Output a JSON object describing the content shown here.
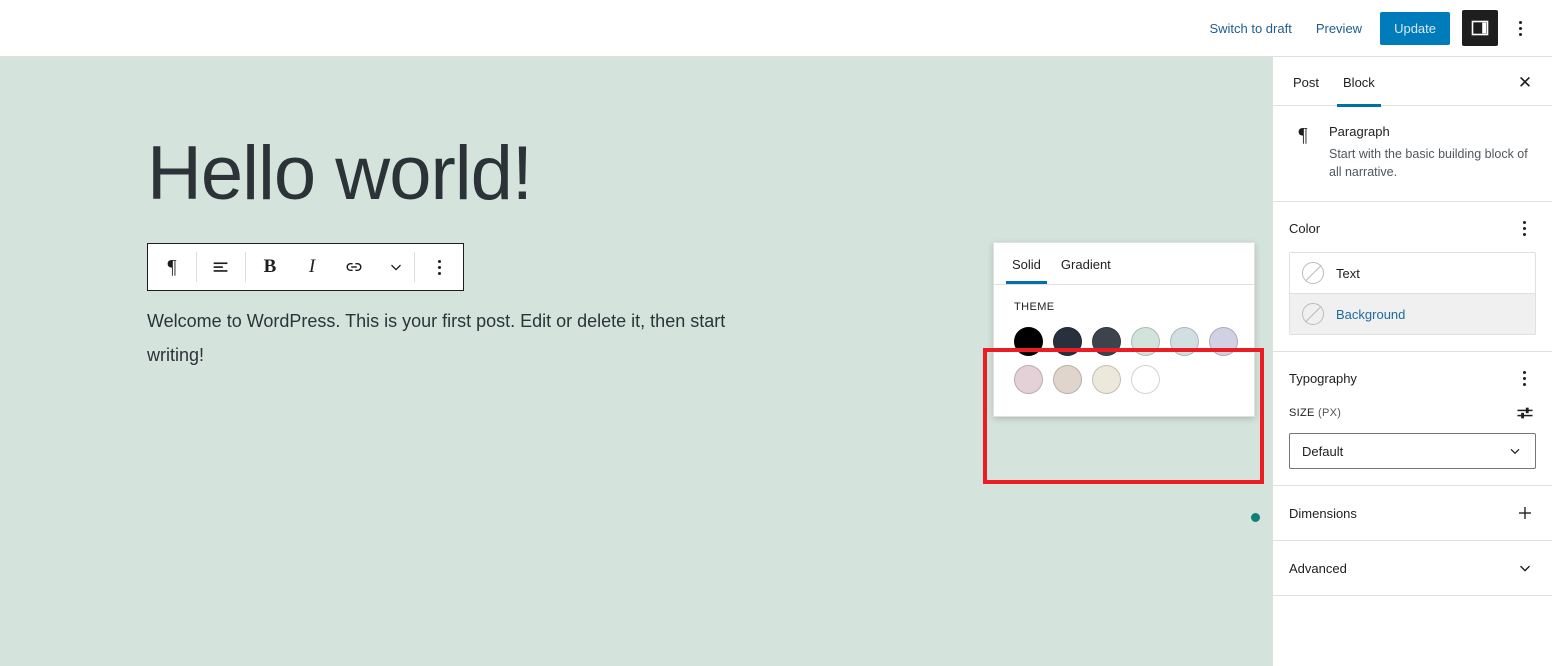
{
  "topbar": {
    "switch_to_draft": "Switch to draft",
    "preview": "Preview",
    "update": "Update",
    "sidebar_toggle_name": "settings-panel-icon",
    "options_name": "more-options-icon",
    "accent_color": "#007cba"
  },
  "canvas": {
    "background_color": "#d4e4dc",
    "title": "Hello world!",
    "body": "Welcome to WordPress. This is your first post. Edit or delete it, then start writing!",
    "indicator_color": "#0f8076"
  },
  "block_toolbar": {
    "buttons": [
      {
        "name": "block-type-paragraph",
        "glyph": "¶"
      },
      {
        "name": "align-text-icon",
        "glyph": ""
      },
      {
        "name": "bold-button",
        "glyph": "B"
      },
      {
        "name": "italic-button",
        "glyph": "I"
      },
      {
        "name": "link-button",
        "glyph": ""
      },
      {
        "name": "more-rich-text-icon",
        "glyph": ""
      },
      {
        "name": "block-options-icon",
        "glyph": ""
      }
    ]
  },
  "color_popover": {
    "tabs": [
      {
        "label": "Solid",
        "active": true
      },
      {
        "label": "Gradient",
        "active": false
      }
    ],
    "group_label": "THEME",
    "swatches": [
      {
        "name": "swatch-black",
        "color": "#000000"
      },
      {
        "name": "swatch-dark-navy",
        "color": "#28303d"
      },
      {
        "name": "swatch-slate",
        "color": "#3c434d"
      },
      {
        "name": "swatch-mint",
        "color": "#d1e4db"
      },
      {
        "name": "swatch-light-blue",
        "color": "#d1dfe3"
      },
      {
        "name": "swatch-lavender",
        "color": "#d1d1e4"
      },
      {
        "name": "swatch-pink",
        "color": "#e4d1d8"
      },
      {
        "name": "swatch-beige",
        "color": "#e0d5cc"
      },
      {
        "name": "swatch-cream",
        "color": "#ece8dc"
      },
      {
        "name": "swatch-white",
        "color": "#ffffff"
      }
    ],
    "highlight_color": "#ec1c24"
  },
  "sidebar": {
    "tabs": [
      {
        "label": "Post",
        "active": false
      },
      {
        "label": "Block",
        "active": true
      }
    ],
    "close_glyph": "✕",
    "block": {
      "icon_glyph": "¶",
      "title": "Paragraph",
      "description": "Start with the basic building block of all narrative."
    },
    "color_panel": {
      "title": "Color",
      "rows": [
        {
          "label": "Text",
          "selected": false
        },
        {
          "label": "Background",
          "selected": true
        }
      ]
    },
    "typography_panel": {
      "title": "Typography",
      "size_label": "SIZE",
      "size_unit": "(PX)",
      "size_value": "Default"
    },
    "dimensions_panel": {
      "title": "Dimensions",
      "toggle": "plus-icon"
    },
    "advanced_panel": {
      "title": "Advanced",
      "toggle": "chevron-down-icon"
    }
  }
}
